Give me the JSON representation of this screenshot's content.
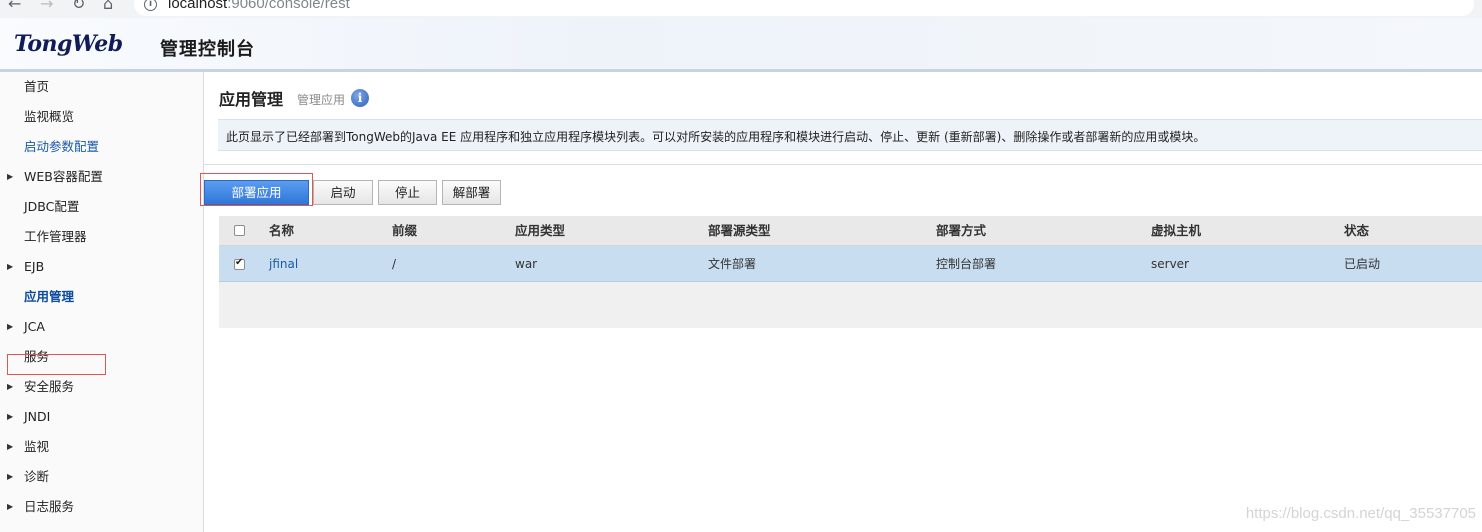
{
  "browser": {
    "url_host": "localhost",
    "url_path": ":9060/console/rest",
    "back_icon": "arrow-left-icon",
    "forward_icon": "arrow-right-icon",
    "reload_icon": "reload-icon",
    "home_icon": "home-icon"
  },
  "header": {
    "logo": "TongWeb",
    "subtitle": "管理控制台"
  },
  "sidebar": {
    "items": [
      {
        "label": "首页",
        "expandable": false,
        "style": "normal"
      },
      {
        "label": "监视概览",
        "expandable": false,
        "style": "normal"
      },
      {
        "label": "启动参数配置",
        "expandable": false,
        "style": "link"
      },
      {
        "label": "WEB容器配置",
        "expandable": true,
        "style": "normal"
      },
      {
        "label": "JDBC配置",
        "expandable": false,
        "style": "normal"
      },
      {
        "label": "工作管理器",
        "expandable": false,
        "style": "normal"
      },
      {
        "label": "EJB",
        "expandable": true,
        "style": "normal"
      },
      {
        "label": "应用管理",
        "expandable": false,
        "style": "active"
      },
      {
        "label": "JCA",
        "expandable": true,
        "style": "normal"
      },
      {
        "label": "服务",
        "expandable": false,
        "style": "normal"
      },
      {
        "label": "安全服务",
        "expandable": true,
        "style": "normal"
      },
      {
        "label": "JNDI",
        "expandable": true,
        "style": "normal"
      },
      {
        "label": "监视",
        "expandable": true,
        "style": "normal"
      },
      {
        "label": "诊断",
        "expandable": true,
        "style": "normal"
      },
      {
        "label": "日志服务",
        "expandable": true,
        "style": "normal"
      }
    ]
  },
  "main": {
    "title": "应用管理",
    "subtitle": "管理应用",
    "help_icon": "i",
    "description": "此页显示了已经部署到TongWeb的Java EE 应用程序和独立应用程序模块列表。可以对所安装的应用程序和模块进行启动、停止、更新 (重新部署)、删除操作或者部署新的应用或模块。",
    "buttons": {
      "deploy": "部署应用",
      "start": "启动",
      "stop": "停止",
      "undeploy": "解部署"
    },
    "table": {
      "columns": [
        "名称",
        "前缀",
        "应用类型",
        "部署源类型",
        "部署方式",
        "虚拟主机",
        "状态"
      ],
      "rows": [
        {
          "name": "jfinal",
          "prefix": "/",
          "type": "war",
          "source": "文件部署",
          "mode": "控制台部署",
          "host": "server",
          "status": "已启动",
          "checked": true
        }
      ]
    }
  },
  "watermark": "https://blog.csdn.net/qq_35537705",
  "colors": {
    "accent": "#2f77d8",
    "row_selected": "#c9ddf0",
    "highlight_box": "#e25555",
    "link": "#1a5aa8"
  }
}
